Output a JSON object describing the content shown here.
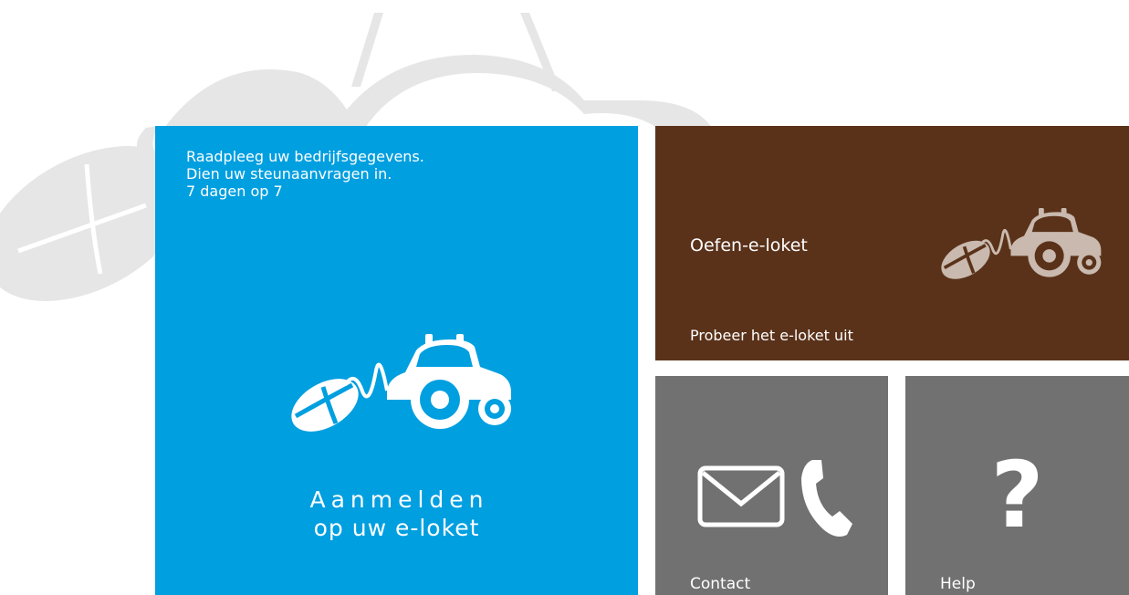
{
  "login_tile": {
    "intro_lines": [
      "Raadpleeg uw bedrijfsgegevens.",
      "Dien uw steunaanvragen in.",
      "7 dagen op 7"
    ],
    "title_line1": "Aanmelden",
    "title_line2": "op uw e-loket",
    "color": "#009fe0"
  },
  "practice_tile": {
    "title": "Oefen-e-loket",
    "subtitle": "Probeer het e-loket uit",
    "color": "#5a321a"
  },
  "contact_tile": {
    "label": "Contact",
    "color": "#717171"
  },
  "help_tile": {
    "label": "Help",
    "icon_glyph": "?",
    "color": "#717171"
  },
  "icons": {
    "login": "mouse-tractor-icon",
    "practice": "mouse-tractor-icon",
    "contact": [
      "envelope-icon",
      "phone-icon"
    ],
    "help": "question-mark-icon",
    "background": "tractor-watermark"
  }
}
